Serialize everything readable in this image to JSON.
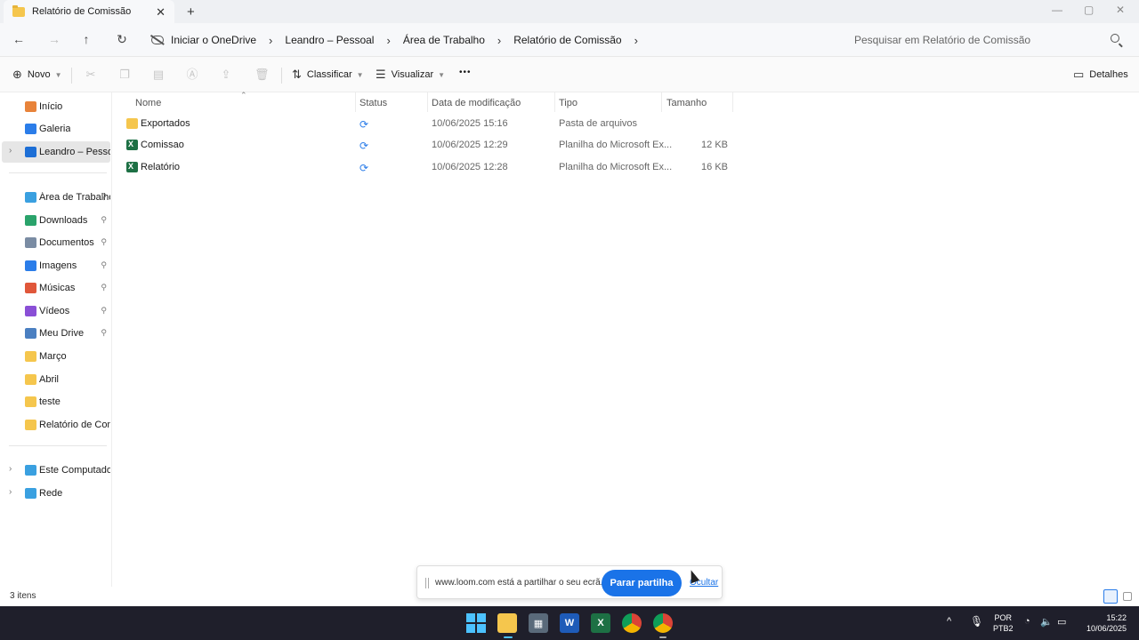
{
  "tab": {
    "title": "Relatório de Comissão",
    "close": "✕",
    "new_tab": "+"
  },
  "window_controls": {
    "minimize": "—",
    "maximize": "▢",
    "close": "✕"
  },
  "nav": {
    "back": "←",
    "forward": "→",
    "up": "↑",
    "refresh": "↻"
  },
  "breadcrumb": {
    "items": [
      "Iniciar o OneDrive",
      "Leandro – Pessoal",
      "Área de Trabalho",
      "Relatório de Comissão"
    ],
    "sep": "›"
  },
  "search": {
    "placeholder": "Pesquisar em Relatório de Comissão"
  },
  "commands": {
    "new": "Novo",
    "sort": "Classificar",
    "view": "Visualizar",
    "more": "•••",
    "details": "Detalhes"
  },
  "sidebar": {
    "top": [
      {
        "label": "Início",
        "icon": "home-icon",
        "color": "#e8833a"
      },
      {
        "label": "Galeria",
        "icon": "gallery-icon",
        "color": "#2b7de9"
      },
      {
        "label": "Leandro – Pessoal",
        "icon": "onedrive-icon",
        "color": "#1d6fd6"
      }
    ],
    "quick": [
      {
        "label": "Área de Trabalho",
        "icon": "desktop-icon",
        "color": "#3aa0e0",
        "pinned": true
      },
      {
        "label": "Downloads",
        "icon": "download-icon",
        "color": "#2aa36b",
        "pinned": true
      },
      {
        "label": "Documentos",
        "icon": "documents-icon",
        "color": "#7a8ca3",
        "pinned": true
      },
      {
        "label": "Imagens",
        "icon": "pictures-icon",
        "color": "#2b7de9",
        "pinned": true
      },
      {
        "label": "Músicas",
        "icon": "music-icon",
        "color": "#e0573a",
        "pinned": true
      },
      {
        "label": "Vídeos",
        "icon": "videos-icon",
        "color": "#8a4fd6",
        "pinned": true
      },
      {
        "label": "Meu Drive",
        "icon": "drive-icon",
        "color": "#4a7fc1",
        "pinned": true
      },
      {
        "label": "Março",
        "icon": "folder-icon",
        "color": "#f5c64d",
        "pinned": false
      },
      {
        "label": "Abril",
        "icon": "folder-icon",
        "color": "#f5c64d",
        "pinned": false
      },
      {
        "label": "teste",
        "icon": "folder-icon",
        "color": "#f5c64d",
        "pinned": false
      },
      {
        "label": "Relatório de Comissão",
        "icon": "folder-icon",
        "color": "#f5c64d",
        "pinned": false
      }
    ],
    "bottom": [
      {
        "label": "Este Computador",
        "icon": "computer-icon",
        "color": "#3aa0e0"
      },
      {
        "label": "Rede",
        "icon": "network-icon",
        "color": "#3aa0e0"
      }
    ],
    "pin_glyph": "📌",
    "chevron": "›"
  },
  "columns": {
    "name": "Nome",
    "status": "Status",
    "date": "Data de modificação",
    "type": "Tipo",
    "size": "Tamanho"
  },
  "files": [
    {
      "name": "Exportados",
      "status": "⟳",
      "date": "10/06/2025 15:16",
      "type": "Pasta de arquivos",
      "size": "",
      "kind": "folder"
    },
    {
      "name": "Comissao",
      "status": "⟳",
      "date": "10/06/2025 12:29",
      "type": "Planilha do Microsoft Ex...",
      "size": "12 KB",
      "kind": "excel"
    },
    {
      "name": "Relatório",
      "status": "⟳",
      "date": "10/06/2025 12:28",
      "type": "Planilha do Microsoft Ex...",
      "size": "16 KB",
      "kind": "excel"
    }
  ],
  "status_bar": {
    "count": "3 itens"
  },
  "loom": {
    "text": "www.loom.com está a partilhar o seu ecrã.",
    "stop": "Parar partilha",
    "hide": "Ocultar"
  },
  "taskbar": {
    "apps": [
      {
        "name": "start-icon"
      },
      {
        "name": "file-explorer-icon",
        "color": "#f5c64d"
      },
      {
        "name": "calculator-icon",
        "color": "#5a6a7a"
      },
      {
        "name": "word-icon",
        "color": "#1e5bb8",
        "letter": "W"
      },
      {
        "name": "excel-icon",
        "color": "#1d7044",
        "letter": "X"
      },
      {
        "name": "chrome-icon",
        "color": "#db4437"
      },
      {
        "name": "chrome-profile-icon",
        "color": "#0f9d58"
      }
    ],
    "lang_1": "POR",
    "lang_2": "PTB2",
    "time": "15:22",
    "date": "10/06/2025",
    "tray_up": "^"
  }
}
